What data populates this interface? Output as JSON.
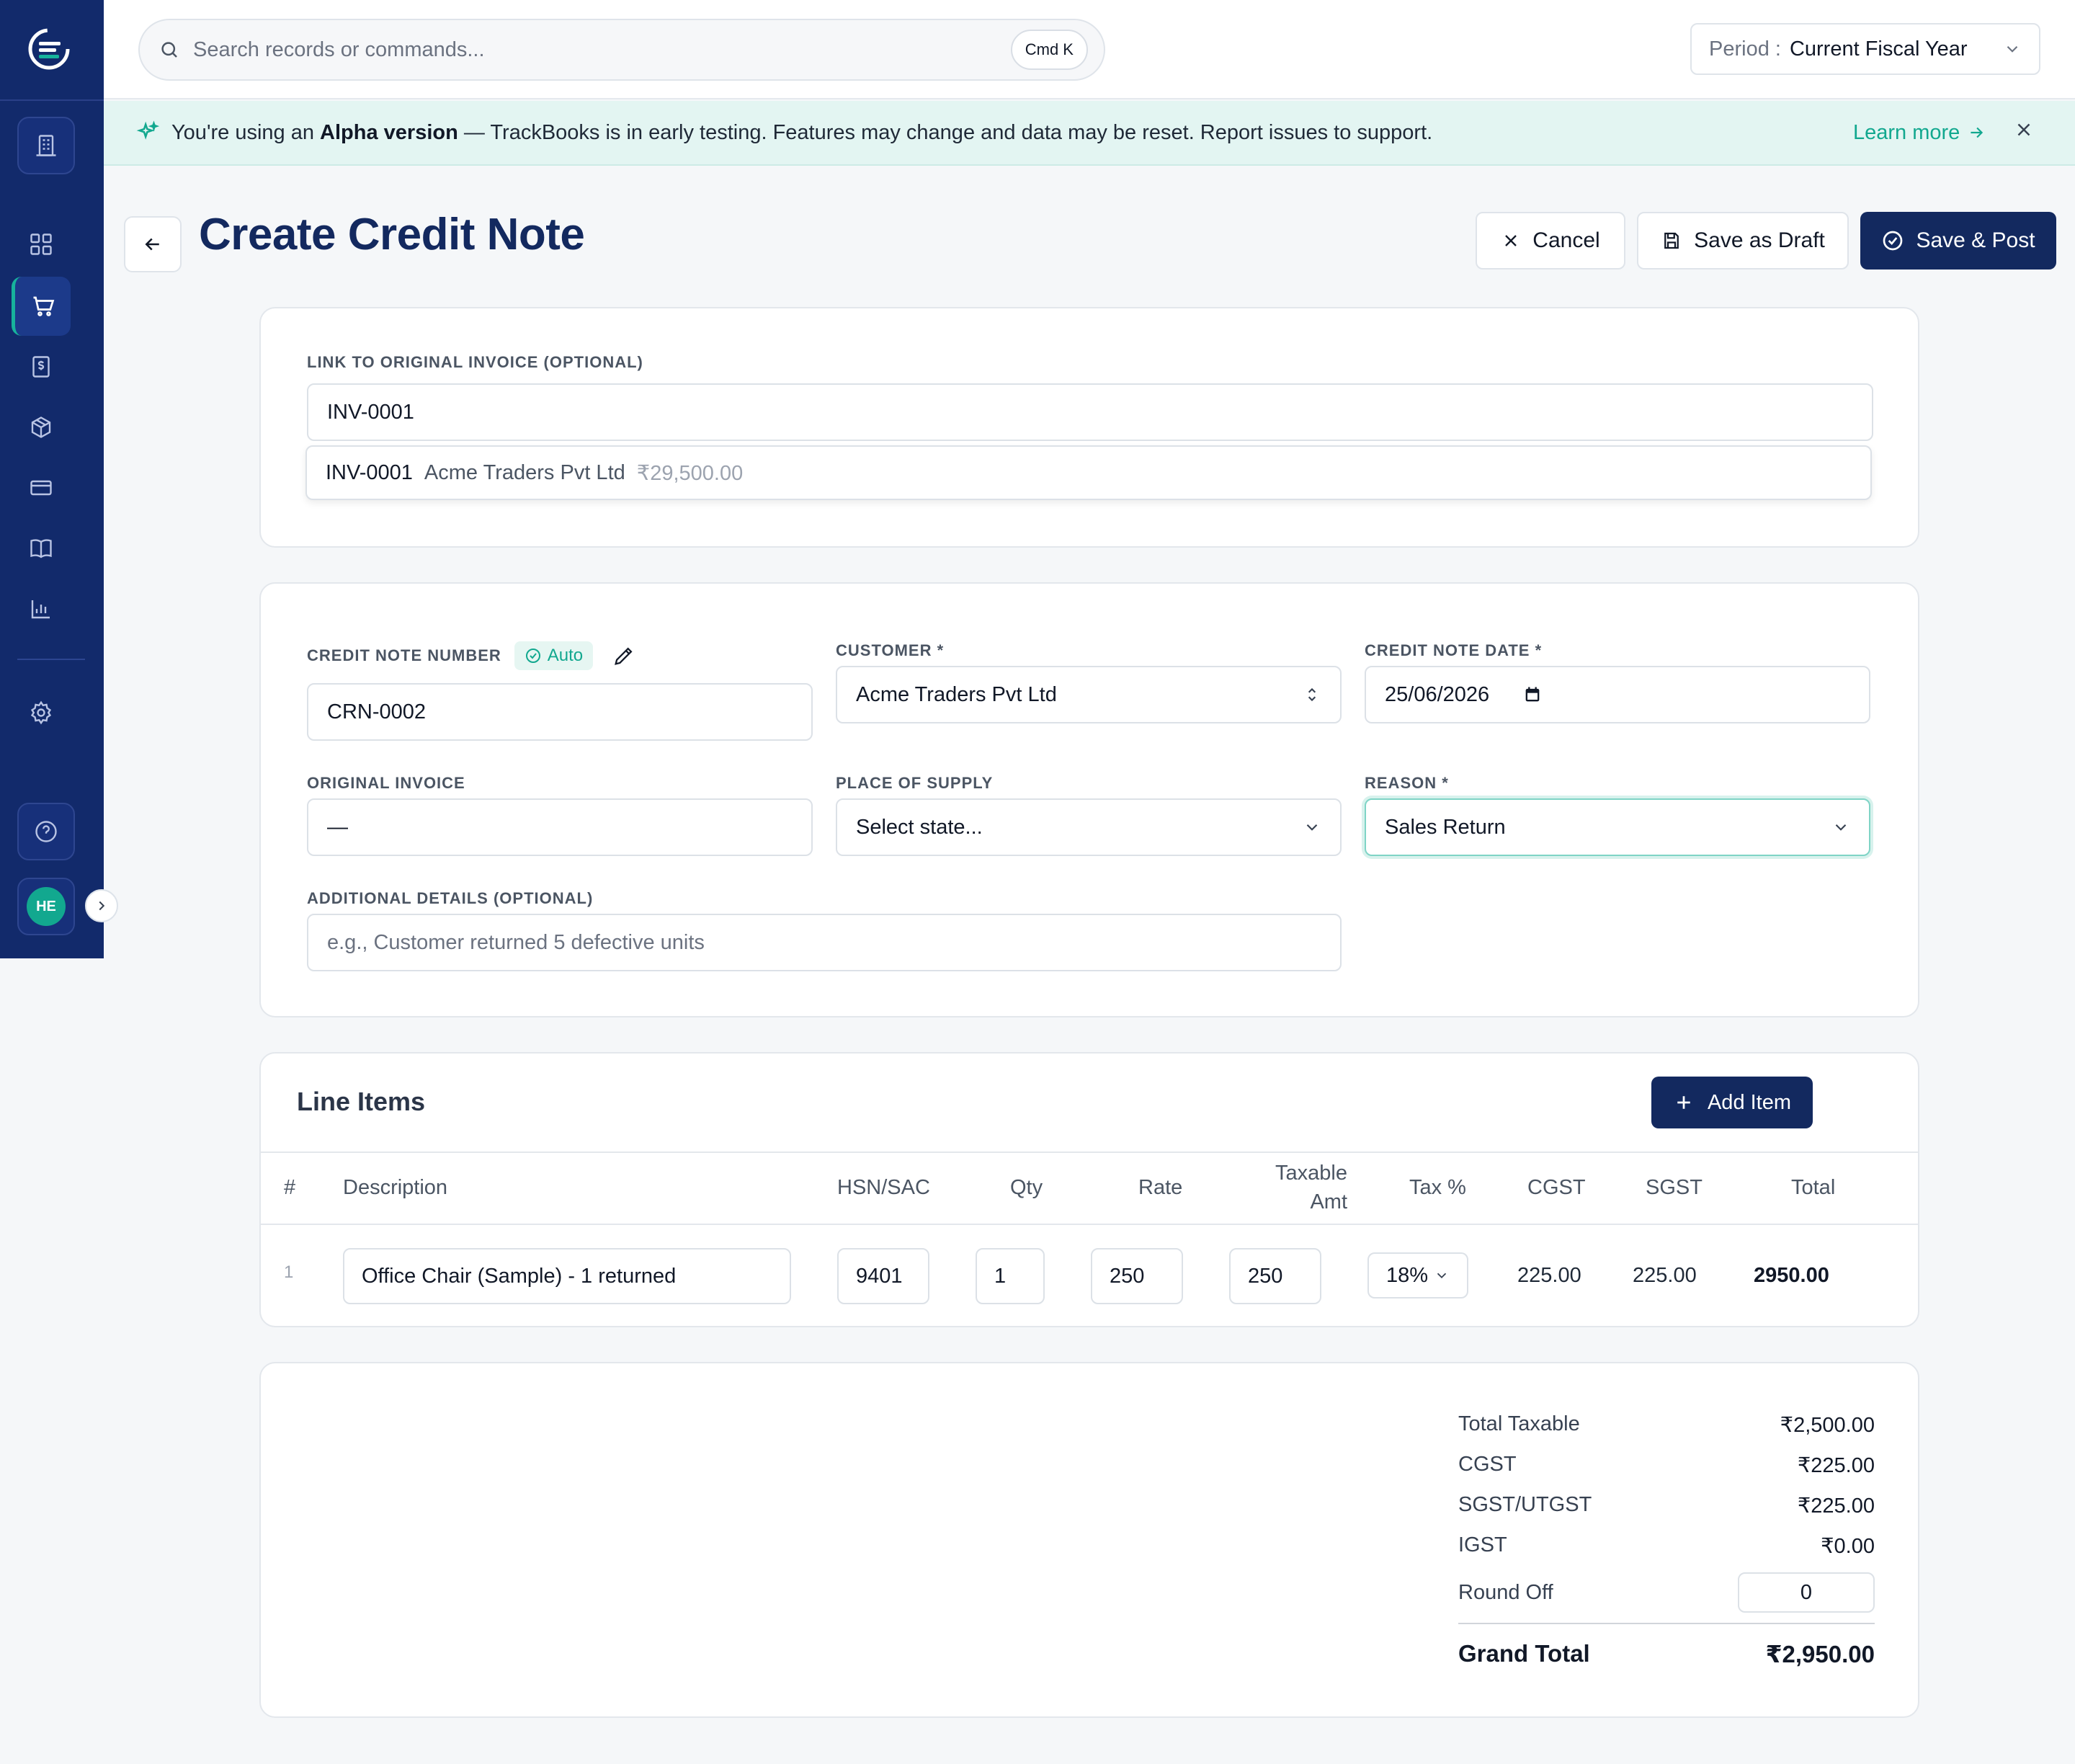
{
  "topbar": {
    "search_placeholder": "Search records or commands...",
    "search_shortcut": "Cmd K",
    "period_label": "Period :",
    "period_value": "Current Fiscal Year"
  },
  "banner": {
    "prefix": "You're using an ",
    "highlight": "Alpha version",
    "message": " — TrackBooks is in early testing. Features may change and data may be reset. Report issues to support.",
    "learn_more": "Learn more"
  },
  "sidebar": {
    "avatar_initials": "HE",
    "items": [
      {
        "icon": "dashboard-icon"
      },
      {
        "icon": "cart-icon",
        "active": true
      },
      {
        "icon": "receipt-dollar-icon"
      },
      {
        "icon": "box-icon"
      },
      {
        "icon": "credit-card-icon"
      },
      {
        "icon": "book-icon"
      },
      {
        "icon": "bar-chart-icon"
      },
      {
        "icon": "gear-icon"
      }
    ]
  },
  "header": {
    "title": "Create Credit Note",
    "cancel_label": "Cancel",
    "draft_label": "Save as Draft",
    "post_label": "Save & Post"
  },
  "link_invoice": {
    "label": "LINK TO ORIGINAL INVOICE (OPTIONAL)",
    "value": "INV-0001",
    "suggestion": {
      "number": "INV-0001",
      "customer": "Acme Traders Pvt Ltd",
      "amount": "₹29,500.00"
    }
  },
  "form": {
    "credit_note_number_label": "CREDIT NOTE NUMBER",
    "auto_badge": "Auto",
    "credit_note_number": "CRN-0002",
    "customer_label": "CUSTOMER *",
    "customer_value": "Acme Traders Pvt Ltd",
    "date_label": "CREDIT NOTE DATE *",
    "date_value": "25/06/2026",
    "original_invoice_label": "ORIGINAL INVOICE",
    "original_invoice_value": "—",
    "place_of_supply_label": "PLACE OF SUPPLY",
    "place_of_supply_value": "Select state...",
    "reason_label": "REASON *",
    "reason_value": "Sales Return",
    "additional_label": "ADDITIONAL DETAILS (OPTIONAL)",
    "additional_placeholder": "e.g., Customer returned 5 defective units"
  },
  "line_items": {
    "title": "Line Items",
    "add_label": "Add Item",
    "columns": {
      "num": "#",
      "description": "Description",
      "hsn": "HSN/SAC",
      "qty": "Qty",
      "rate": "Rate",
      "taxable_1": "Taxable",
      "taxable_2": "Amt",
      "tax": "Tax %",
      "cgst": "CGST",
      "sgst": "SGST",
      "total": "Total"
    },
    "rows": [
      {
        "num": "1",
        "description": "Office Chair (Sample) - 1 returned",
        "hsn": "9401",
        "qty": "1",
        "rate": "250",
        "taxable": "250",
        "tax": "18%",
        "cgst": "225.00",
        "sgst": "225.00",
        "total": "2950.00"
      }
    ]
  },
  "totals": {
    "taxable_label": "Total Taxable",
    "taxable_value": "₹2,500.00",
    "cgst_label": "CGST",
    "cgst_value": "₹225.00",
    "sgst_label": "SGST/UTGST",
    "sgst_value": "₹225.00",
    "igst_label": "IGST",
    "igst_value": "₹0.00",
    "roundoff_label": "Round Off",
    "roundoff_value": "0",
    "grand_label": "Grand Total",
    "grand_value": "₹2,950.00"
  },
  "colors": {
    "navy": "#13295f",
    "sidebar": "#122a6b",
    "teal": "#12a88f",
    "banner_bg": "#e3f5f2"
  }
}
